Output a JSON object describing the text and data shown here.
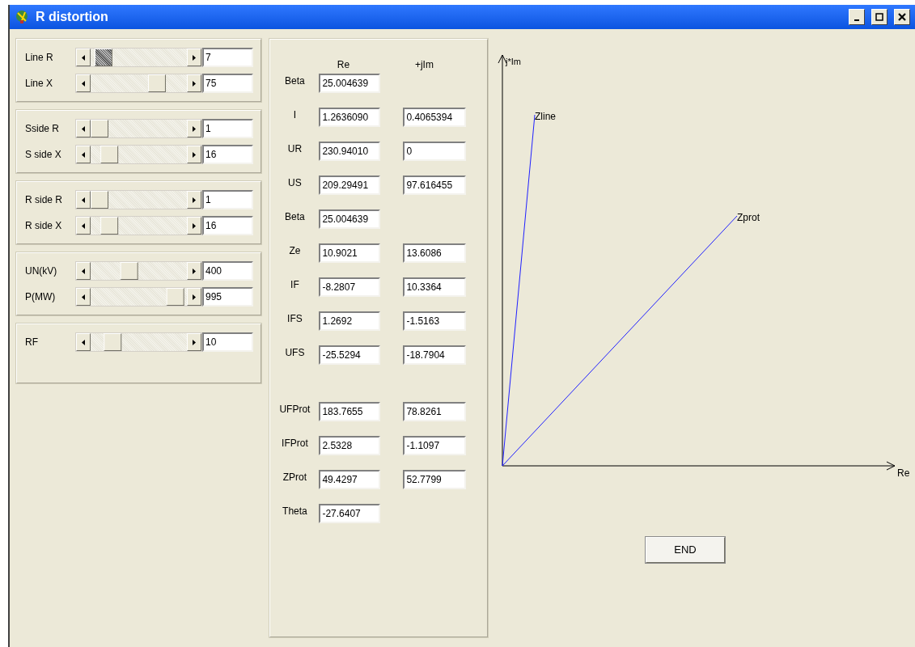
{
  "window": {
    "title": "R distortion"
  },
  "slider_groups": [
    {
      "sliders": [
        {
          "label": "Line R",
          "level": 0.05,
          "focused": true,
          "value": "7"
        },
        {
          "label": "Line X",
          "level": 0.73,
          "focused": false,
          "value": "75"
        }
      ]
    },
    {
      "sliders": [
        {
          "label": "Sside R",
          "level": 0.0,
          "focused": false,
          "value": "1"
        },
        {
          "label": "S side X",
          "level": 0.13,
          "focused": false,
          "value": "16"
        }
      ]
    },
    {
      "sliders": [
        {
          "label": "R side R",
          "level": 0.0,
          "focused": false,
          "value": "1"
        },
        {
          "label": "R side X",
          "level": 0.13,
          "focused": false,
          "value": "16"
        }
      ]
    },
    {
      "sliders": [
        {
          "label": "UN(kV)",
          "level": 0.38,
          "focused": false,
          "value": "400"
        },
        {
          "label": "P(MW)",
          "level": 0.97,
          "focused": false,
          "value": "995"
        }
      ]
    },
    {
      "sliders": [
        {
          "label": "RF",
          "level": 0.17,
          "focused": false,
          "value": "10"
        }
      ]
    }
  ],
  "results": {
    "columns": [
      "Re",
      "+jIm"
    ],
    "rows": [
      {
        "label": "Beta",
        "re": "25.004639"
      },
      {
        "label": "I",
        "re": "1.2636090",
        "im": "0.4065394"
      },
      {
        "label": "UR",
        "re": "230.94010",
        "im": "0"
      },
      {
        "label": "US",
        "re": "209.29491",
        "im": "97.616455"
      },
      {
        "label": "Beta",
        "re": "25.004639"
      },
      {
        "label": "Ze",
        "re": "10.9021",
        "im": "13.6086"
      },
      {
        "label": "IF",
        "re": "-8.2807",
        "im": "10.3364"
      },
      {
        "label": "IFS",
        "re": "1.2692",
        "im": "-1.5163"
      },
      {
        "label": "UFS",
        "re": "-25.5294",
        "im": "-18.7904"
      }
    ],
    "protection_rows": [
      {
        "label": "UFProt",
        "re": "183.7655",
        "im": "78.8261"
      },
      {
        "label": "IFProt",
        "re": "2.5328",
        "im": "-1.1097"
      },
      {
        "label": "ZProt",
        "re": "49.4297",
        "im": "52.7799"
      },
      {
        "label": "Theta",
        "re": "-27.6407"
      }
    ]
  },
  "diagram": {
    "y_axis_label": "j*Im",
    "x_axis_label": "Re",
    "vectors": [
      {
        "label": "Zline"
      },
      {
        "label": "Zprot"
      }
    ]
  },
  "end_button": "END"
}
